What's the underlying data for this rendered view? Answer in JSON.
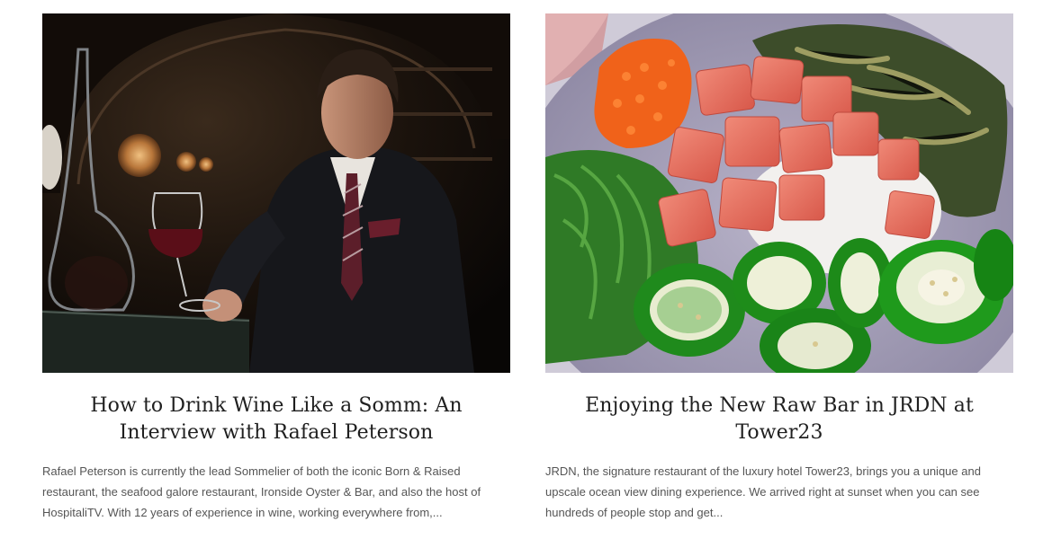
{
  "posts": [
    {
      "image_alt": "Rafael Peterson holding a glass of red wine at a dark bar",
      "title": "How to Drink Wine Like a Somm: An Interview with Rafael Peterson",
      "excerpt": "Rafael Peterson is currently the lead Sommelier of both the iconic Born & Raised restaurant, the seafood galore restaurant, Ironside Oyster & Bar, and also the host of HospitaliTV. With 12 years of experience in wine, working everywhere from,..."
    },
    {
      "image_alt": "Poke bowl with raw fish, seaweed salad, roe and sliced jalapeños",
      "title": "Enjoying the New Raw Bar in JRDN at Tower23",
      "excerpt": "JRDN, the signature restaurant of the luxury hotel Tower23, brings you a unique and upscale ocean view dining experience. We arrived right at sunset when you can see hundreds of people stop and get..."
    }
  ],
  "colors": {
    "title": "#1f1f1f",
    "excerpt": "#555555"
  }
}
